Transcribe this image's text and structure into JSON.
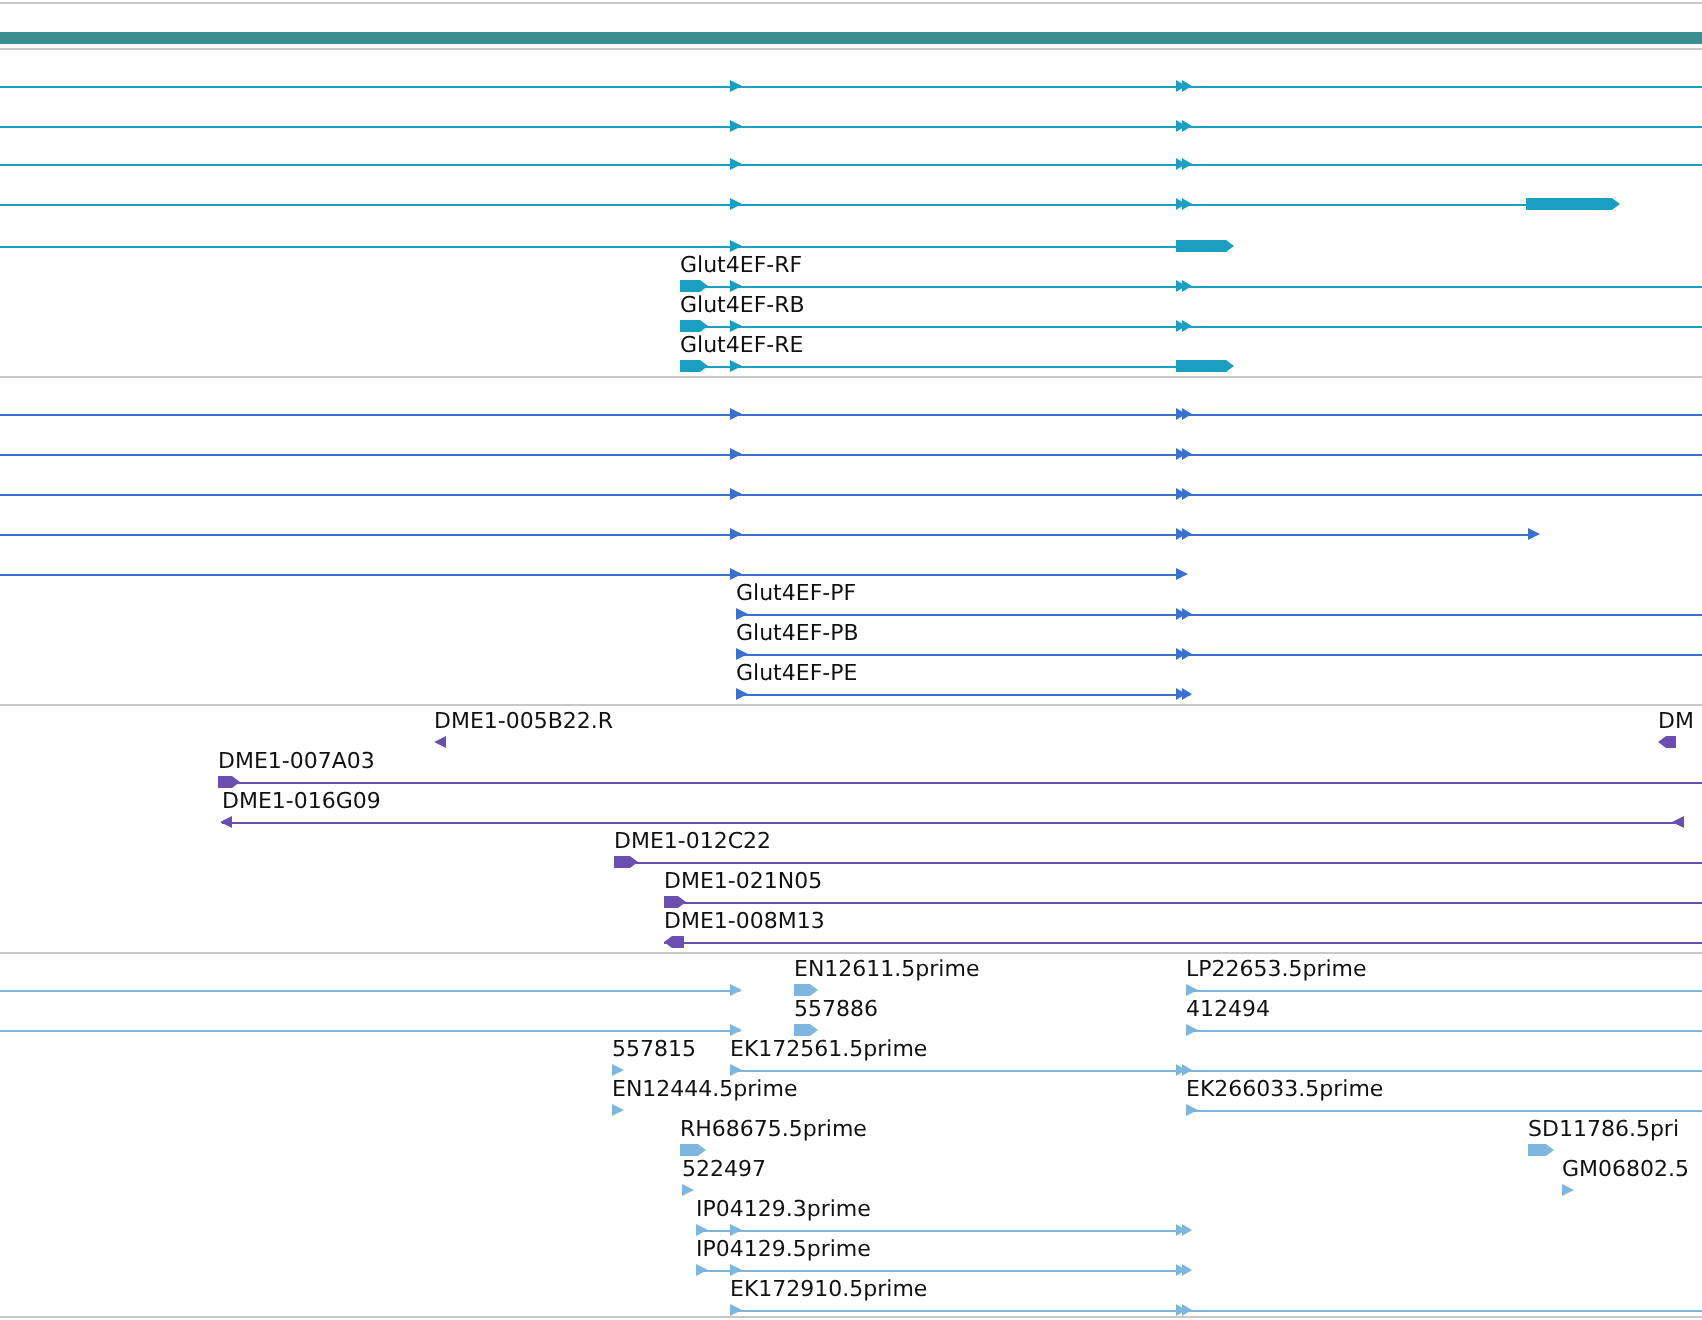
{
  "tracks": [
    {
      "color": "#1a9ec2",
      "features": [
        {
          "reverse": false
        },
        {
          "reverse": false
        },
        {
          "reverse": false
        },
        {
          "reverse": false
        },
        {
          "reverse": false
        },
        {
          "label": "Glut4EF-RF",
          "reverse": false
        },
        {
          "label": "Glut4EF-RB",
          "reverse": false
        },
        {
          "label": "Glut4EF-RE",
          "reverse": false
        }
      ]
    },
    {
      "color": "#3a70d0",
      "features": [
        {
          "reverse": false
        },
        {
          "reverse": false
        },
        {
          "reverse": false
        },
        {
          "reverse": false
        },
        {
          "reverse": false
        },
        {
          "label": "Glut4EF-PF",
          "reverse": false
        },
        {
          "label": "Glut4EF-PB",
          "reverse": false
        },
        {
          "label": "Glut4EF-PE",
          "reverse": false
        }
      ]
    },
    {
      "color": "#6a4fb0",
      "features": [
        {
          "label": "DME1-005B22.R",
          "reverse": true
        },
        {
          "label": "DM",
          "reverse": true
        },
        {
          "label": "DME1-007A03",
          "reverse": false
        },
        {
          "label": "DME1-016G09",
          "reverse": true
        },
        {
          "label": "DME1-012C22",
          "reverse": false
        },
        {
          "label": "DME1-021N05",
          "reverse": false
        },
        {
          "label": "DME1-008M13",
          "reverse": true
        }
      ]
    },
    {
      "color": "#7fb6df",
      "features": [
        {
          "reverse": false
        },
        {
          "label": "EN12611.5prime",
          "reverse": false
        },
        {
          "label": "LP22653.5prime",
          "reverse": false
        },
        {
          "reverse": false
        },
        {
          "label": "557886",
          "reverse": false
        },
        {
          "label": "412494",
          "reverse": false
        },
        {
          "label": "557815",
          "reverse": false
        },
        {
          "label": "EK172561.5prime",
          "reverse": false
        },
        {
          "label": "EN12444.5prime",
          "reverse": false
        },
        {
          "label": "EK266033.5prime",
          "reverse": false
        },
        {
          "label": "RH68675.5prime",
          "reverse": false
        },
        {
          "label": "SD11786.5pri",
          "reverse": false
        },
        {
          "label": "522497",
          "reverse": false
        },
        {
          "label": "GM06802.5",
          "reverse": false
        },
        {
          "label": "IP04129.3prime",
          "reverse": false
        },
        {
          "label": "IP04129.5prime",
          "reverse": false
        },
        {
          "label": "EK172910.5prime",
          "reverse": false
        }
      ]
    }
  ]
}
